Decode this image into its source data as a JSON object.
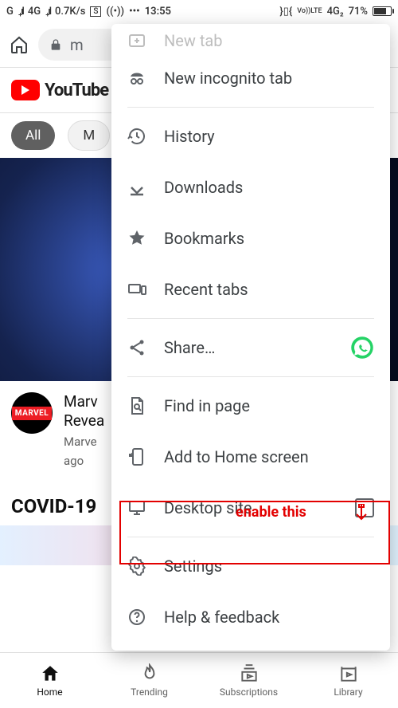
{
  "status": {
    "left": {
      "net1": "G",
      "net2": "4G",
      "speed": "0.7K/s",
      "sbox": "S"
    },
    "time": "13:55",
    "right": {
      "volte": "Vo))​LTE",
      "sig2": "4G₂",
      "battery": "71%"
    }
  },
  "toolbar": {
    "url_prefix": "m"
  },
  "youtube": {
    "brand": "YouTube"
  },
  "chips": {
    "all": "All",
    "second": "M"
  },
  "video": {
    "title_line1": "Marv",
    "title_line2": "Revea",
    "channel": "Marve",
    "age": "ago",
    "avatar": "MARVEL"
  },
  "covid": {
    "title": "COVID-19"
  },
  "bottom_nav": {
    "home": "Home",
    "trending": "Trending",
    "subscriptions": "Subscriptions",
    "library": "Library"
  },
  "menu": {
    "new_tab": "New tab",
    "incognito": "New incognito tab",
    "history": "History",
    "downloads": "Downloads",
    "bookmarks": "Bookmarks",
    "recent_tabs": "Recent tabs",
    "share": "Share…",
    "find": "Find in page",
    "add_home": "Add to Home screen",
    "desktop": "Desktop site",
    "settings": "Settings",
    "help": "Help & feedback"
  },
  "annotation": {
    "text": "enable this"
  }
}
